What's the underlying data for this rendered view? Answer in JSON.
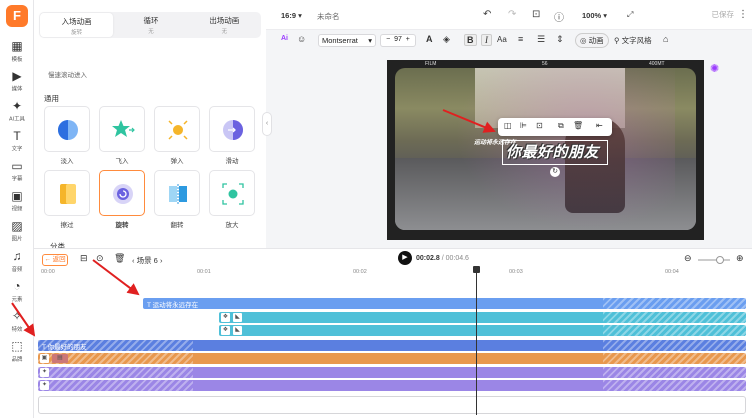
{
  "rail": {
    "items": [
      {
        "label": "模板",
        "icon": "grid-icon"
      },
      {
        "label": "媒体",
        "icon": "media-icon"
      },
      {
        "label": "AI工具",
        "icon": "ai-icon"
      },
      {
        "label": "文字",
        "icon": "text-icon"
      },
      {
        "label": "字幕",
        "icon": "subtitle-icon"
      },
      {
        "label": "视频",
        "icon": "video-icon"
      },
      {
        "label": "图片",
        "icon": "image-icon"
      },
      {
        "label": "音频",
        "icon": "music-icon"
      },
      {
        "label": "元素",
        "icon": "shapes-icon"
      },
      {
        "label": "特效",
        "icon": "sparkle-icon"
      },
      {
        "label": "品牌",
        "icon": "brand-icon"
      }
    ]
  },
  "panel": {
    "tabs": [
      {
        "label": "入场动画",
        "sub": "旋转"
      },
      {
        "label": "循环",
        "sub": "无"
      },
      {
        "label": "出场动画",
        "sub": "无"
      }
    ],
    "partial_top": "慢速滚动进入",
    "section_general": "通用",
    "effects": [
      "淡入",
      "飞入",
      "弹入",
      "滑动",
      "擦过",
      "旋转",
      "翻转",
      "放大"
    ],
    "section_next": "分类"
  },
  "topbar": {
    "ratio": "16:9",
    "ratio_caret": "▾",
    "doc_title": "未命名",
    "zoom": "100%",
    "save_label": "已保存"
  },
  "toolbar": {
    "ai_label": "Ai",
    "font": "Montserrat",
    "minus": "−",
    "size": "97",
    "plus": "+",
    "bold": "B",
    "italic": "I",
    "case": "Aa",
    "animation_label": "动画",
    "text_style_label": "文字风格"
  },
  "canvas": {
    "film_left": "FILM",
    "film_mid": "56",
    "film_right": "400MT",
    "small_text": "运动将永远存在",
    "title_text": "你最好的朋友"
  },
  "timeline": {
    "back_label": "返回",
    "scene_label": "场景 6",
    "current_time": "00:02.8",
    "total_time": "/ 00:04.6",
    "ruler": [
      "00:00",
      "00:01",
      "00:02",
      "00:03",
      "00:04"
    ],
    "tracks": [
      {
        "label": "运动将永远存在",
        "color": "#6a9ef0"
      },
      {
        "label": "",
        "color": "#4fc0d8"
      },
      {
        "label": "",
        "color": "#4fc0d8"
      },
      {
        "label": "你最好的朋友",
        "color": "#5b7fe0"
      },
      {
        "label": "",
        "color": "#e8984e"
      },
      {
        "label": "",
        "color": "#9b86e6"
      },
      {
        "label": "",
        "color": "#9b86e6"
      },
      {
        "label": "",
        "color": "#9b86e6"
      }
    ]
  },
  "colors": {
    "accent": "#ff7a2a",
    "annotation_arrow": "#e02020"
  }
}
